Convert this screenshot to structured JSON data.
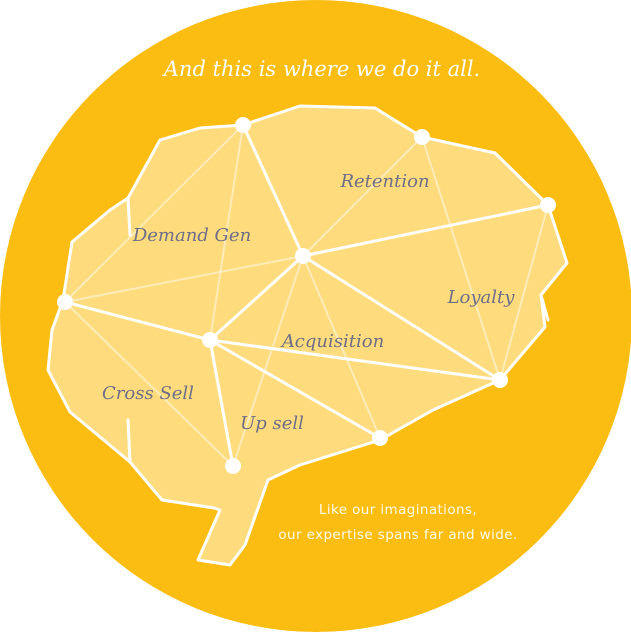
{
  "headline": "And this is where we do it all.",
  "regions": {
    "retention": "Retention",
    "demand_gen": "Demand Gen",
    "loyalty": "Loyalty",
    "acquisition": "Acquisition",
    "cross_sell": "Cross Sell",
    "up_sell": "Up sell"
  },
  "caption": {
    "line1": "Like our imaginations,",
    "line2": "our expertise spans far and wide."
  },
  "colors": {
    "circle": "#fbbd12",
    "brain_fill": "#fedd83",
    "brain_stroke": "#ffffff",
    "label_text": "#6e6e86"
  }
}
